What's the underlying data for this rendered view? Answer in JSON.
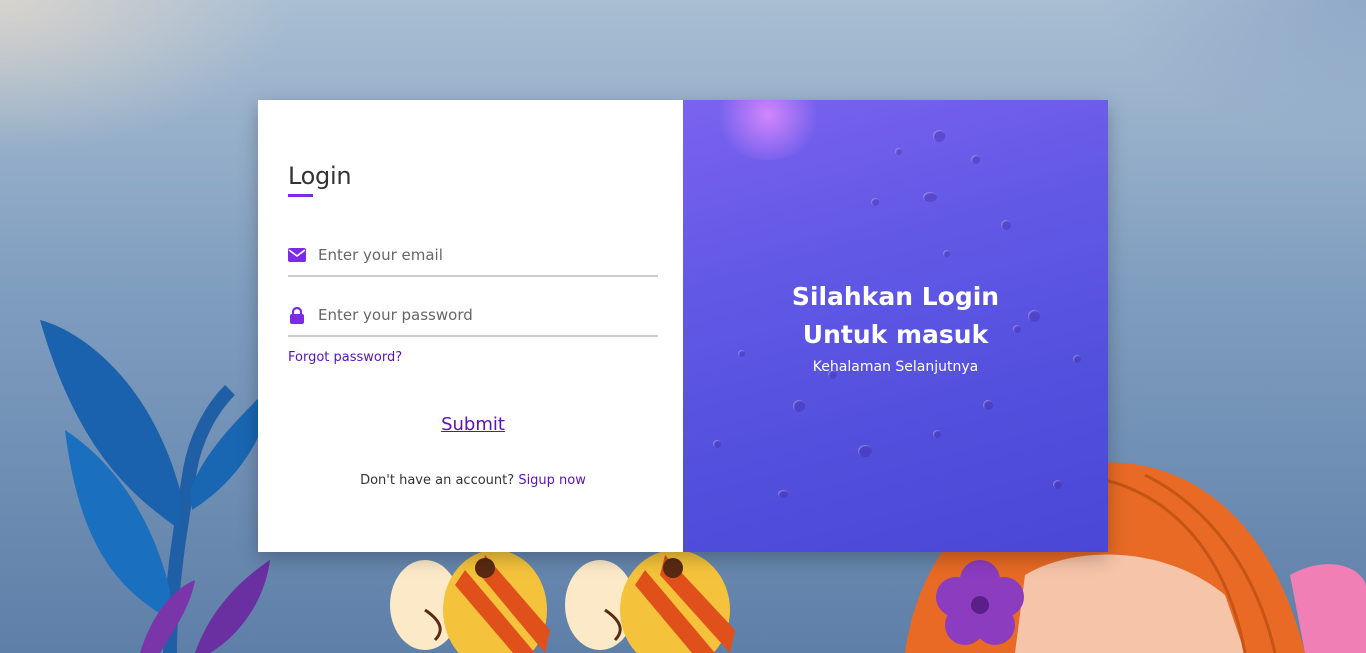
{
  "login": {
    "title": "Login",
    "email": {
      "placeholder": "Enter your email",
      "icon": "envelope-icon"
    },
    "password": {
      "placeholder": "Enter your password",
      "icon": "lock-icon"
    },
    "forgot_label": "Forgot password?",
    "submit_label": "Submit",
    "signup_prompt": "Don't have an account?",
    "signup_link": "Sigup now"
  },
  "panel": {
    "line1": "Silahkan Login",
    "line2": "Untuk masuk",
    "subtitle": "Kehalaman Selanjutnya"
  },
  "colors": {
    "accent": "#7d2ae8",
    "link": "#5b13b9",
    "panel_start": "#7a63ef",
    "panel_end": "#4a47d6"
  }
}
